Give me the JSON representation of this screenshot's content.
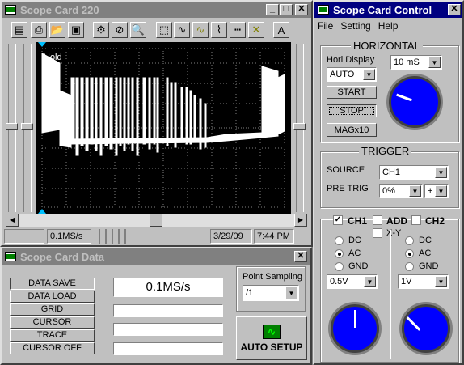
{
  "scope": {
    "title": "Scope Card 220",
    "hold_label": "Hold",
    "status": {
      "rate": "0.1MS/s",
      "date": "3/29/09",
      "time": "7:44 PM"
    }
  },
  "data_win": {
    "title": "Scope Card Data",
    "buttons": [
      "DATA SAVE",
      "DATA LOAD",
      "GRID",
      "CURSOR",
      "TRACE",
      "CURSOR OFF"
    ],
    "readouts": [
      "0.1MS/s",
      "",
      "",
      ""
    ],
    "point_sampling_label": "Point Sampling",
    "point_sampling_value": "/1",
    "auto_setup_label": "AUTO SETUP"
  },
  "control": {
    "title": "Scope Card Control",
    "menu": [
      "File",
      "Setting",
      "Help"
    ],
    "horizontal": {
      "header": "HORIZONTAL",
      "hori_display_label": "Hori Display",
      "hori_display_value": "AUTO",
      "timebase_value": "10 mS",
      "start_label": "START",
      "stop_label": "STOP",
      "mag_label": "MAGx10"
    },
    "trigger": {
      "header": "TRIGGER",
      "source_label": "SOURCE",
      "source_value": "CH1",
      "pretrig_label": "PRE TRIG",
      "pretrig_value": "0%",
      "slope_value": "+"
    },
    "channels": {
      "ch1_label": "CH1",
      "add_label": "ADD",
      "ch2_label": "CH2",
      "xy_label": "X-Y",
      "ch1": {
        "coupling": [
          "DC",
          "AC",
          "GND"
        ],
        "selected": "AC",
        "volts": "0.5V"
      },
      "ch2": {
        "coupling": [
          "DC",
          "AC",
          "GND"
        ],
        "selected": "AC",
        "volts": "1V"
      }
    }
  },
  "colors": {
    "title_active": "#000080",
    "screen_bg": "#000000",
    "grid": "#808080",
    "trace": "#ffffff",
    "knob": "#0000ff"
  }
}
